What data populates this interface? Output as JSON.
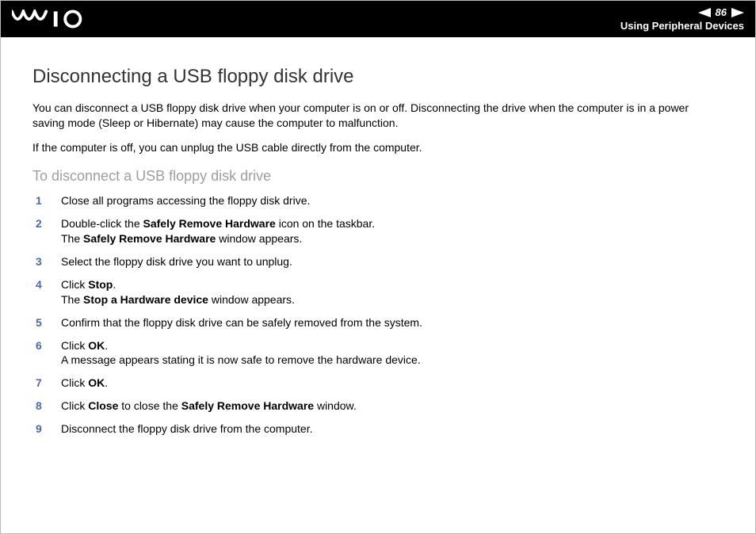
{
  "header": {
    "page_number": "86",
    "breadcrumb": "Using Peripheral Devices"
  },
  "title": "Disconnecting a USB floppy disk drive",
  "paragraphs": [
    "You can disconnect a USB floppy disk drive when your computer is on or off. Disconnecting the drive when the computer is in a power saving mode (Sleep or Hibernate) may cause the computer to malfunction.",
    "If the computer is off, you can unplug the USB cable directly from the computer."
  ],
  "subheading": "To disconnect a USB floppy disk drive",
  "steps": [
    {
      "segments": [
        {
          "text": "Close all programs accessing the floppy disk drive.",
          "bold": false
        }
      ]
    },
    {
      "segments": [
        {
          "text": "Double-click the ",
          "bold": false
        },
        {
          "text": "Safely Remove Hardware",
          "bold": true
        },
        {
          "text": " icon on the taskbar.",
          "bold": false
        },
        {
          "br": true
        },
        {
          "text": "The ",
          "bold": false
        },
        {
          "text": "Safely Remove Hardware",
          "bold": true
        },
        {
          "text": " window appears.",
          "bold": false
        }
      ]
    },
    {
      "segments": [
        {
          "text": "Select the floppy disk drive you want to unplug.",
          "bold": false
        }
      ]
    },
    {
      "segments": [
        {
          "text": "Click ",
          "bold": false
        },
        {
          "text": "Stop",
          "bold": true
        },
        {
          "text": ".",
          "bold": false
        },
        {
          "br": true
        },
        {
          "text": "The ",
          "bold": false
        },
        {
          "text": "Stop a Hardware device",
          "bold": true
        },
        {
          "text": " window appears.",
          "bold": false
        }
      ]
    },
    {
      "segments": [
        {
          "text": "Confirm that the floppy disk drive can be safely removed from the system.",
          "bold": false
        }
      ]
    },
    {
      "segments": [
        {
          "text": "Click ",
          "bold": false
        },
        {
          "text": "OK",
          "bold": true
        },
        {
          "text": ".",
          "bold": false
        },
        {
          "br": true
        },
        {
          "text": "A message appears stating it is now safe to remove the hardware device.",
          "bold": false
        }
      ]
    },
    {
      "segments": [
        {
          "text": "Click ",
          "bold": false
        },
        {
          "text": "OK",
          "bold": true
        },
        {
          "text": ".",
          "bold": false
        }
      ]
    },
    {
      "segments": [
        {
          "text": "Click ",
          "bold": false
        },
        {
          "text": "Close",
          "bold": true
        },
        {
          "text": " to close the ",
          "bold": false
        },
        {
          "text": "Safely Remove Hardware",
          "bold": true
        },
        {
          "text": " window.",
          "bold": false
        }
      ]
    },
    {
      "segments": [
        {
          "text": "Disconnect the floppy disk drive from the computer.",
          "bold": false
        }
      ]
    }
  ]
}
